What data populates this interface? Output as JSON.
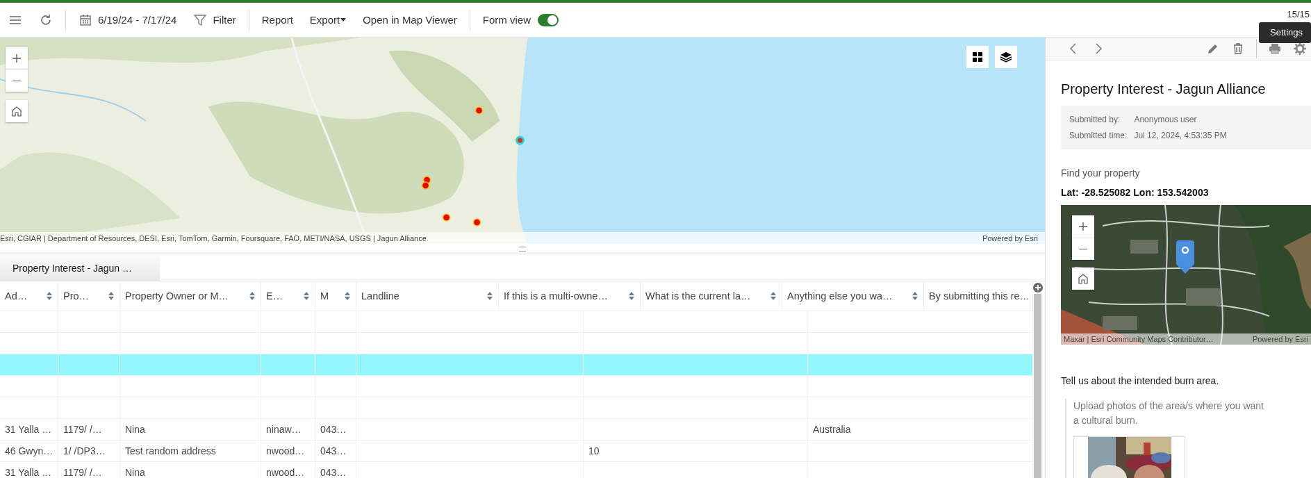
{
  "toolbar": {
    "date_range": "6/19/24 - 7/17/24",
    "filter": "Filter",
    "actions": [
      {
        "label": "Report",
        "kind": "plain"
      },
      {
        "label": "Export",
        "kind": "menu"
      },
      {
        "label": "Open in Map Viewer",
        "kind": "plain"
      }
    ],
    "form_view": {
      "label": "Form view",
      "on": true
    },
    "counter": "15/15"
  },
  "tooltip": "Settings",
  "map": {
    "attribution": "Esri, CGIAR | Department of Resources, DESI, Esri, TomTom, Garmin, Foursquare, FAO, METI/NASA, USGS | Jagun Alliance",
    "powered_by": "Powered by Esri"
  },
  "layer_tabs": [
    {
      "label": "Property Interest - Jagun …",
      "selected": true
    }
  ],
  "table": {
    "columns": [
      "Ad…",
      "Pro…",
      "Property Owner or M…",
      "E…",
      "M",
      "Landline",
      "If this is a multi-owne…",
      "What is the current la…",
      "Anything else you wa…",
      "By submitting this re…"
    ],
    "rows": [
      {
        "selected": false
      },
      {
        "selected": false
      },
      {
        "selected": true
      },
      {
        "selected": false
      },
      {
        "selected": false
      },
      {
        "selected": false,
        "cells": [
          "31 Yalla …",
          "1179/ /…",
          "Nina",
          "ninaw…",
          "043…",
          null,
          null,
          "Australia"
        ]
      },
      {
        "selected": false,
        "cells": [
          "46 Gwyn…",
          "1/ /DP3…",
          "Test random address",
          "nwood…",
          "043…",
          null,
          "10",
          null
        ]
      },
      {
        "selected": false,
        "cells": [
          "31 Yalla …",
          "1179/ /…",
          "Nina",
          "nwood…",
          "043…",
          null,
          null,
          null
        ]
      }
    ]
  },
  "form": {
    "title": "Property Interest - Jagun Alliance",
    "submitted_by_label": "Submitted by:",
    "submitted_by": "Anonymous user",
    "submitted_time_label": "Submitted time:",
    "submitted_time": "Jul 12, 2024, 4:53:35 PM",
    "location_label": "Find your property",
    "coordinates": "Lat: -28.525082 Lon: 153.542003",
    "map_attribution": "Maxar | Esri Community Maps Contributor…",
    "map_powered_by": "Powered by Esri",
    "section": "Tell us about the intended burn area.",
    "upload_label": "Upload photos of the area/s where you want a cultural burn."
  }
}
